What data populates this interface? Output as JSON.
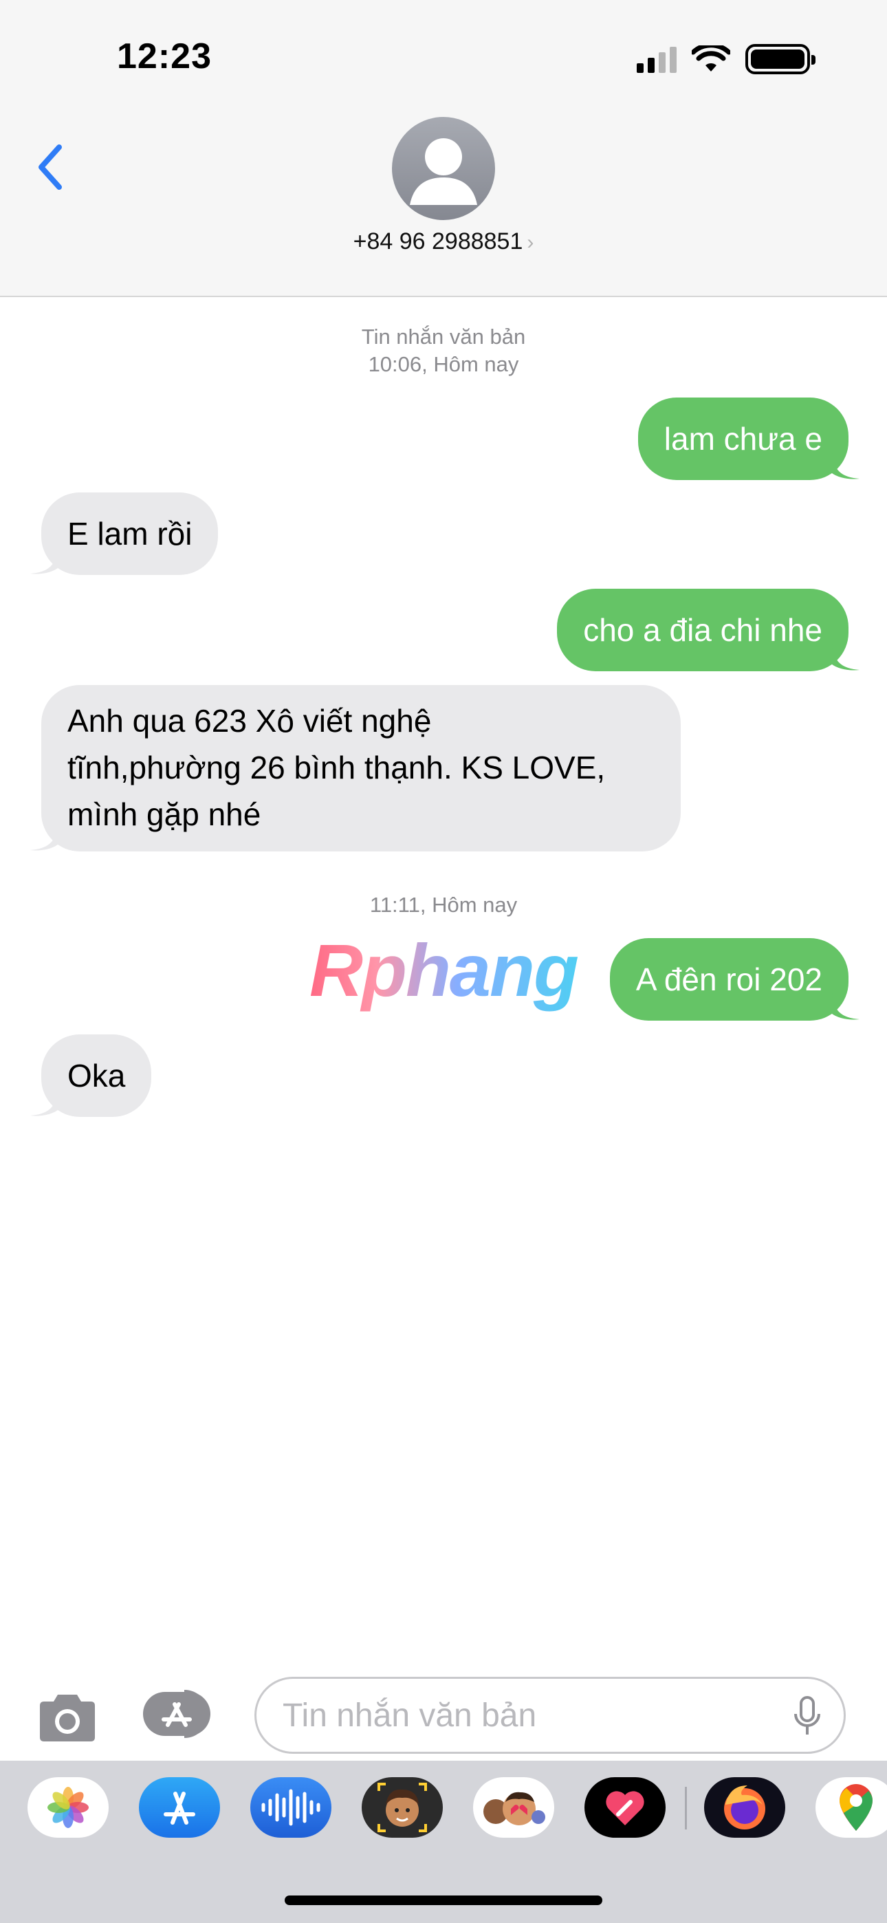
{
  "status_bar": {
    "time": "12:23"
  },
  "header": {
    "contact": "+84 96 2988851",
    "chevron": "›"
  },
  "messages": {
    "ts1_line1": "Tin nhắn văn bản",
    "ts1_line2": "10:06, Hôm nay",
    "m1": "lam chưa e",
    "m2": "E lam rồi",
    "m3": "cho a đia chi nhe",
    "m4_line1": "Anh qua 623 Xô viết nghệ",
    "m4_line2": "tĩnh,phường 26 bình thạnh. KS LOVE,",
    "m4_line3": "mình gặp nhé",
    "ts2": "11:11, Hôm nay",
    "m5": "A đên roi 202",
    "m6": "Oka"
  },
  "watermark": "Rphang",
  "input": {
    "placeholder": "Tin nhắn văn bản"
  },
  "colors": {
    "sent": "#65c466",
    "received": "#e9e9eb",
    "accent": "#2f7cf6"
  },
  "icons": [
    "signal-icon",
    "wifi-icon",
    "battery-icon",
    "back-chevron-icon",
    "contact-avatar-icon",
    "camera-icon",
    "app-store-toggle-icon",
    "microphone-icon"
  ],
  "drawer_apps": [
    "photos-app",
    "app-store-app",
    "audio-app",
    "memoji-app",
    "animoji-app",
    "digital-touch-app",
    "firefox-app",
    "google-maps-app"
  ]
}
